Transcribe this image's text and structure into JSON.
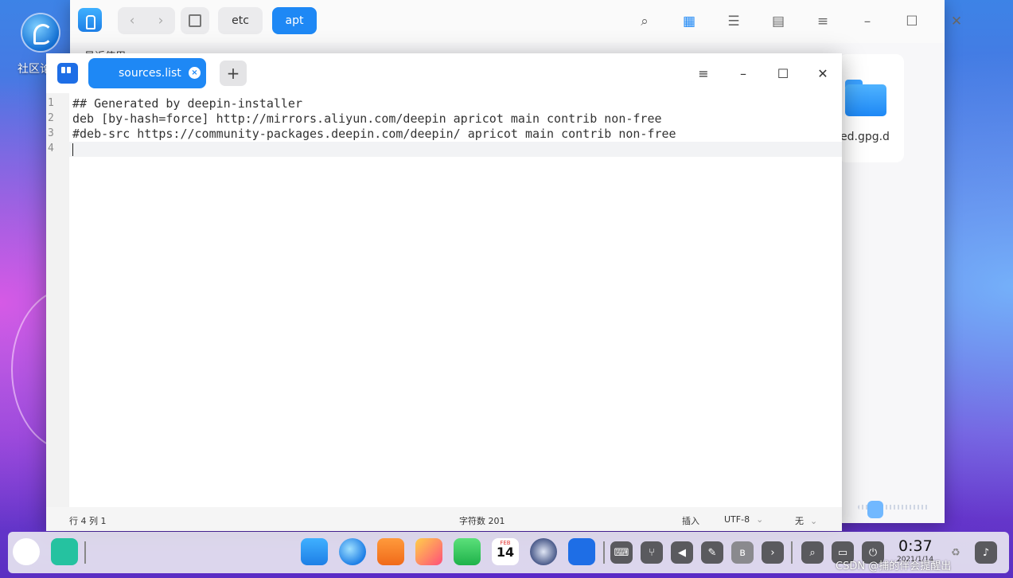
{
  "desktop": {
    "icon_label": "社区论"
  },
  "file_manager": {
    "nav_back": "‹",
    "nav_forward": "›",
    "breadcrumbs": [
      "etc",
      "apt"
    ],
    "sidebar_partial": "最近使用",
    "folder_label": "ed.gpg.d",
    "toolbar": {
      "search": "⌕",
      "icon_view": "▦",
      "list_view": "☰",
      "tree_view": "▤",
      "menu": "≡",
      "minimize": "–",
      "maximize": "☐",
      "close": "✕"
    }
  },
  "editor": {
    "tab_label": "sources.list",
    "tab_close": "×",
    "add_tab": "+",
    "window_controls": {
      "menu": "≡",
      "minimize": "–",
      "maximize": "☐",
      "close": "✕"
    },
    "line_numbers": [
      "1",
      "2",
      "3",
      "4"
    ],
    "lines": [
      "## Generated by deepin-installer",
      "deb [by-hash=force] http://mirrors.aliyun.com/deepin apricot main contrib non-free",
      "#deb-src https://community-packages.deepin.com/deepin/ apricot main contrib non-free",
      ""
    ],
    "status": {
      "position": "行 4  列 1",
      "char_count": "字符数 201",
      "insert_mode": "插入",
      "encoding": "UTF-8",
      "highlight": "无",
      "chevron": "⌄"
    }
  },
  "dock": {
    "clock_time": "0:37",
    "clock_date": "2021/1/14",
    "calendar_month": "FEB",
    "calendar_day": "14",
    "watermark": "CSDN @捕的伴会提醒出"
  },
  "colors": {
    "accent": "#1e88f5",
    "editor_logo": "#1e6ee6",
    "dock_bg": "#eeeef2"
  }
}
